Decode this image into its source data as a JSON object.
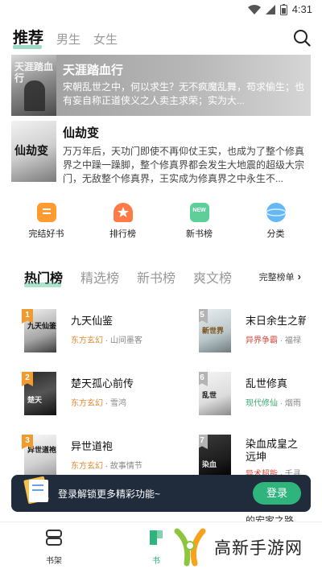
{
  "status_bar": {
    "time": "4:31"
  },
  "top_tabs": [
    {
      "label": "推荐",
      "active": true
    },
    {
      "label": "男生",
      "active": false
    },
    {
      "label": "女生",
      "active": false
    }
  ],
  "featured": [
    {
      "title": "天涯踏血行",
      "cover_text": "天涯踏血行",
      "description": "宋朝乱世之中，何以求生？无不疯魔乱舞，苟求偷生；也有妄自称正道侠义之人卖主求荣；实为大..."
    },
    {
      "title": "仙劫变",
      "cover_text": "仙劫变",
      "description": "万万年后，天功门即使不再仰仗王实，也成为了整个修真界之中躁一躁脚，整个修真界都会发生大地震的超级大宗门，无敌整个修真界，王实成为修真界之中永生不..."
    }
  ],
  "quick_entries": [
    {
      "label": "完结好书",
      "icon": "book-complete-icon"
    },
    {
      "label": "排行榜",
      "icon": "trophy-icon"
    },
    {
      "label": "新书榜",
      "icon": "new-badge-icon",
      "icon_text": "NEW"
    },
    {
      "label": "分类",
      "icon": "category-planet-icon"
    }
  ],
  "rank_tabs": [
    {
      "label": "热门榜",
      "active": true
    },
    {
      "label": "精选榜",
      "active": false
    },
    {
      "label": "新书榜",
      "active": false
    },
    {
      "label": "爽文榜",
      "active": false
    }
  ],
  "full_list_label": "完整榜单",
  "rank_list": [
    {
      "rank": "1",
      "title": "九天仙鉴",
      "genre": "东方玄幻",
      "author": "山间墨客",
      "cover_text": "九天仙鉴"
    },
    {
      "rank": "5",
      "title": "末日余生之新",
      "genre": "异界争霸",
      "author": "福禄",
      "cover_text": "新世界"
    },
    {
      "rank": "2",
      "title": "楚天孤心前传",
      "genre": "东方玄幻",
      "author": "雪鸿",
      "cover_text": "楚天"
    },
    {
      "rank": "6",
      "title": "乱世修真",
      "genre": "现代修仙",
      "author": "烟雨",
      "cover_text": "乱世"
    },
    {
      "rank": "3",
      "title": "异世道袍",
      "genre": "东方玄幻",
      "author": "故事情节",
      "cover_text": "异世道袍"
    },
    {
      "rank": "7",
      "title": "染血成皇之远坤",
      "genre": "异术超能",
      "author": "千寻",
      "cover_text": "染血"
    }
  ],
  "partial_row_text": "的宏家之路",
  "login_banner": {
    "text": "登录解锁更多精彩功能~",
    "button": "登录"
  },
  "bottom_nav": [
    {
      "label": "书架",
      "icon": "bookshelf-icon"
    },
    {
      "label": "书",
      "icon": "bookstore-icon"
    }
  ],
  "watermark": {
    "text": "高新手游网"
  },
  "colors": {
    "accent": "#2fb47d",
    "banner_bg": "#202b3c",
    "genre_orange": "#e08a33",
    "genre_green": "#3aa96e"
  }
}
